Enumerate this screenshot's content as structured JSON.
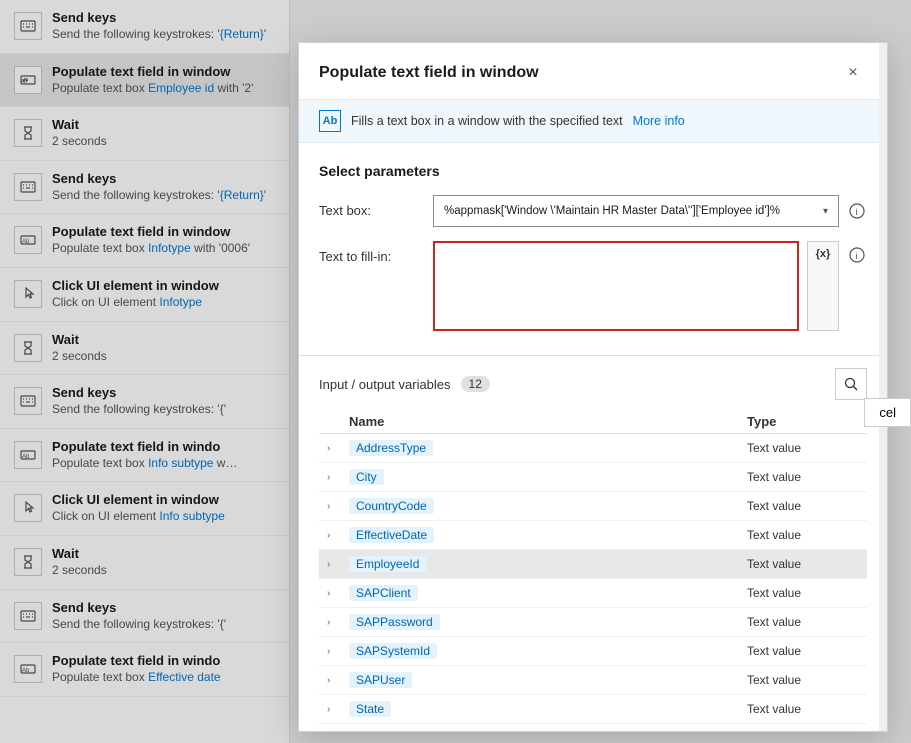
{
  "workflow": {
    "items": [
      {
        "id": "send-keys-1",
        "icon": "keyboard",
        "title": "Send keys",
        "desc": "Send the following keystrokes: '{Return}'"
      },
      {
        "id": "populate-1",
        "icon": "textfield",
        "title": "Populate text field in window",
        "desc": "Populate text box Employee id with '2'",
        "active": true
      },
      {
        "id": "wait-1",
        "icon": "hourglass",
        "title": "Wait",
        "desc": "2 seconds"
      },
      {
        "id": "send-keys-2",
        "icon": "keyboard",
        "title": "Send keys",
        "desc": "Send the following keystrokes: '{Return}'"
      },
      {
        "id": "populate-2",
        "icon": "textfield",
        "title": "Populate text field in window",
        "desc": "Populate text box Infotype with '0006'"
      },
      {
        "id": "click-1",
        "icon": "click",
        "title": "Click UI element in window",
        "desc": "Click on UI element Infotype"
      },
      {
        "id": "wait-2",
        "icon": "hourglass",
        "title": "Wait",
        "desc": "2 seconds"
      },
      {
        "id": "send-keys-3",
        "icon": "keyboard",
        "title": "Send keys",
        "desc": "Send the following keystrokes: '{"
      },
      {
        "id": "populate-3",
        "icon": "textfield",
        "title": "Populate text field in windo",
        "desc": "Populate text box Info subtype w"
      },
      {
        "id": "click-2",
        "icon": "click",
        "title": "Click UI element in window",
        "desc": "Click on UI element Info subtype"
      },
      {
        "id": "wait-3",
        "icon": "hourglass",
        "title": "Wait",
        "desc": "2 seconds"
      },
      {
        "id": "send-keys-4",
        "icon": "keyboard",
        "title": "Send keys",
        "desc": "Send the following keystrokes: '{"
      },
      {
        "id": "populate-4",
        "icon": "textfield",
        "title": "Populate text field in windo",
        "desc": "Populate text box Effective date"
      }
    ]
  },
  "modal": {
    "title": "Populate text field in window",
    "info_text": "Fills a text box in a window with the specified text",
    "more_info_label": "More info",
    "close_label": "×",
    "section_title": "Select parameters",
    "text_box_label": "Text box:",
    "text_box_value": "%appmask['Window \\'Maintain HR Master Data\\'']['Employee id']%",
    "text_fill_label": "Text to fill-in:",
    "text_fill_value": "",
    "variables_label": "Input / output variables",
    "variables_count": "12",
    "search_icon": "search",
    "columns": {
      "name": "Name",
      "type": "Type"
    },
    "variables": [
      {
        "name": "AddressType",
        "type": "Text value",
        "selected": false
      },
      {
        "name": "City",
        "type": "Text value",
        "selected": false
      },
      {
        "name": "CountryCode",
        "type": "Text value",
        "selected": false
      },
      {
        "name": "EffectiveDate",
        "type": "Text value",
        "selected": false
      },
      {
        "name": "EmployeeId",
        "type": "Text value",
        "selected": true
      },
      {
        "name": "SAPClient",
        "type": "Text value",
        "selected": false
      },
      {
        "name": "SAPPassword",
        "type": "Text value",
        "selected": false
      },
      {
        "name": "SAPSystemId",
        "type": "Text value",
        "selected": false
      },
      {
        "name": "SAPUser",
        "type": "Text value",
        "selected": false
      },
      {
        "name": "State",
        "type": "Text value",
        "selected": false
      }
    ],
    "cancel_label": "cel"
  }
}
